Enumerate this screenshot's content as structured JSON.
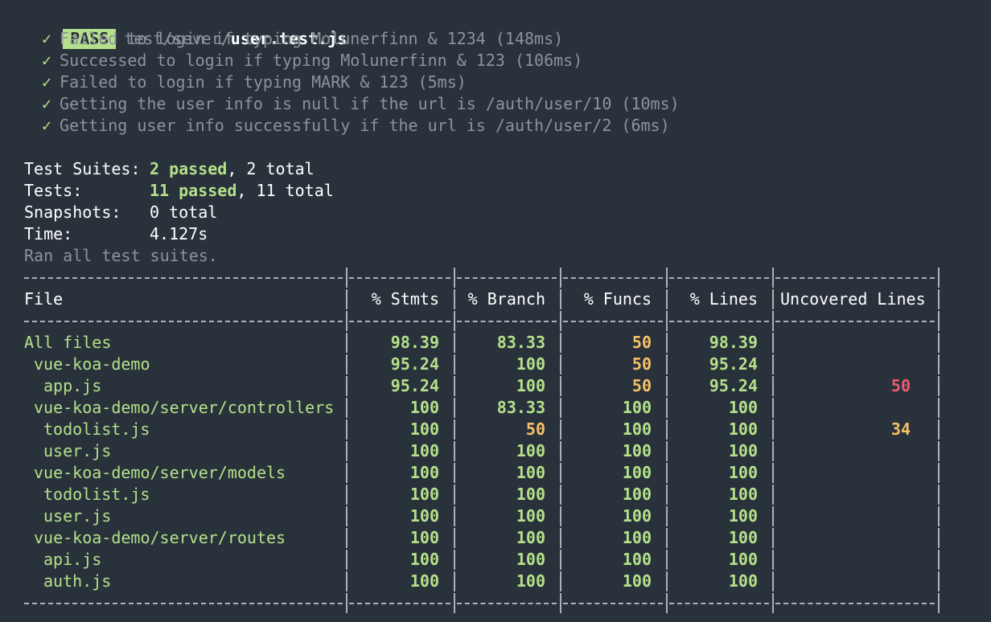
{
  "header": {
    "badge": "PASS",
    "path_prefix": "test/sever/",
    "path_file": "user.test.js"
  },
  "tests": [
    {
      "mark": "✓",
      "text": "Failed to login if typing Molunerfinn & 1234 (148ms)"
    },
    {
      "mark": "✓",
      "text": "Successed to login if typing Molunerfinn & 123 (106ms)"
    },
    {
      "mark": "✓",
      "text": "Failed to login if typing MARK & 123 (5ms)"
    },
    {
      "mark": "✓",
      "text": "Getting the user info is null if the url is /auth/user/10 (10ms)"
    },
    {
      "mark": "✓",
      "text": "Getting user info successfully if the url is /auth/user/2 (6ms)"
    }
  ],
  "summary": {
    "suites_label": "Test Suites:",
    "suites_passed": "2 passed",
    "suites_total": ", 2 total",
    "tests_label": "Tests:",
    "tests_passed": "11 passed",
    "tests_total": ", 11 total",
    "snapshots_label": "Snapshots:",
    "snapshots_value": "0 total",
    "time_label": "Time:",
    "time_value": "4.127s",
    "ran_all": "Ran all test suites."
  },
  "coverage": {
    "headers": {
      "file": "File",
      "stmts": "% Stmts",
      "branch": "% Branch",
      "funcs": "% Funcs",
      "lines": "% Lines",
      "uncovered": "Uncovered Lines"
    },
    "rows": [
      {
        "file": "All files",
        "indent": 0,
        "stmts": "98.39",
        "branch": "83.33",
        "funcs": "50",
        "lines": "98.39",
        "uncovered": "",
        "funcs_color": "yellow",
        "branch_color": "green",
        "unc_color": "green"
      },
      {
        "file": "vue-koa-demo",
        "indent": 1,
        "stmts": "95.24",
        "branch": "100",
        "funcs": "50",
        "lines": "95.24",
        "uncovered": "",
        "funcs_color": "yellow",
        "branch_color": "green",
        "unc_color": "green"
      },
      {
        "file": "app.js",
        "indent": 2,
        "stmts": "95.24",
        "branch": "100",
        "funcs": "50",
        "lines": "95.24",
        "uncovered": "50",
        "funcs_color": "yellow",
        "branch_color": "green",
        "unc_color": "red"
      },
      {
        "file": "vue-koa-demo/server/controllers",
        "indent": 1,
        "stmts": "100",
        "branch": "83.33",
        "funcs": "100",
        "lines": "100",
        "uncovered": "",
        "funcs_color": "green",
        "branch_color": "green",
        "unc_color": "green"
      },
      {
        "file": "todolist.js",
        "indent": 2,
        "stmts": "100",
        "branch": "50",
        "funcs": "100",
        "lines": "100",
        "uncovered": "34",
        "funcs_color": "green",
        "branch_color": "yellow",
        "unc_color": "yellow"
      },
      {
        "file": "user.js",
        "indent": 2,
        "stmts": "100",
        "branch": "100",
        "funcs": "100",
        "lines": "100",
        "uncovered": "",
        "funcs_color": "green",
        "branch_color": "green",
        "unc_color": "green"
      },
      {
        "file": "vue-koa-demo/server/models",
        "indent": 1,
        "stmts": "100",
        "branch": "100",
        "funcs": "100",
        "lines": "100",
        "uncovered": "",
        "funcs_color": "green",
        "branch_color": "green",
        "unc_color": "green"
      },
      {
        "file": "todolist.js",
        "indent": 2,
        "stmts": "100",
        "branch": "100",
        "funcs": "100",
        "lines": "100",
        "uncovered": "",
        "funcs_color": "green",
        "branch_color": "green",
        "unc_color": "green"
      },
      {
        "file": "user.js",
        "indent": 2,
        "stmts": "100",
        "branch": "100",
        "funcs": "100",
        "lines": "100",
        "uncovered": "",
        "funcs_color": "green",
        "branch_color": "green",
        "unc_color": "green"
      },
      {
        "file": "vue-koa-demo/server/routes",
        "indent": 1,
        "stmts": "100",
        "branch": "100",
        "funcs": "100",
        "lines": "100",
        "uncovered": "",
        "funcs_color": "green",
        "branch_color": "green",
        "unc_color": "green"
      },
      {
        "file": "api.js",
        "indent": 2,
        "stmts": "100",
        "branch": "100",
        "funcs": "100",
        "lines": "100",
        "uncovered": "",
        "funcs_color": "green",
        "branch_color": "green",
        "unc_color": "green"
      },
      {
        "file": "auth.js",
        "indent": 2,
        "stmts": "100",
        "branch": "100",
        "funcs": "100",
        "lines": "100",
        "uncovered": "",
        "funcs_color": "green",
        "branch_color": "green",
        "unc_color": "green"
      }
    ]
  },
  "colors": {
    "background": "#29323b",
    "green": "#b5e08b",
    "yellow": "#f5c069",
    "red": "#ef5a6f",
    "dim": "#8b949c"
  }
}
